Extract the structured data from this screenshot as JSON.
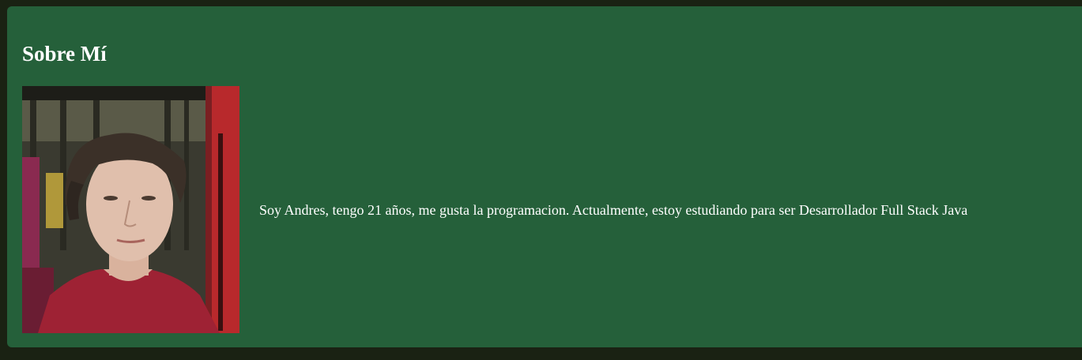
{
  "about": {
    "title": "Sobre Mí",
    "photo_alt": "profile photo",
    "bio": "Soy Andres, tengo 21 años, me gusta la programacion. Actualmente, estoy estudiando para ser Desarrollador Full Stack Java"
  },
  "colors": {
    "page_background": "#1a2213",
    "section_background": "#25603a",
    "text": "#ffffff"
  }
}
